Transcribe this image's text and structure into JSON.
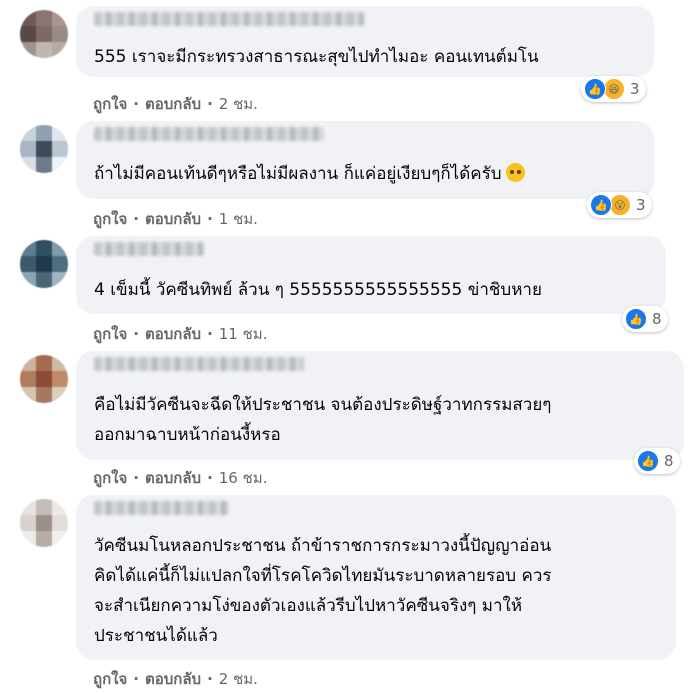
{
  "comments": [
    {
      "lines": [
        "555 เราจะมีกระทรวงสาธารณะสุขไปทำไมอะ คอนเทนต์มโน"
      ],
      "like": "ถูกใจ",
      "reply": "ตอบกลับ",
      "time": "2 ชม.",
      "reaction_count": "3",
      "reaction_icons": [
        "like-icon",
        "haha-icon"
      ],
      "avatar_colors": [
        "#6e5a55",
        "#8a7570",
        "#a8968f",
        "#5a4845",
        "#7d6a66",
        "#9a8a85",
        "#a09290",
        "#c2b6b2",
        "#b5aaa6"
      ]
    },
    {
      "lines": [
        "ถ้าไม่มีคอนเท้นดีๆหรือไม่มีผลงาน ก็แค่อยู่เงียบๆก็ได้ครับ"
      ],
      "like": "ถูกใจ",
      "reply": "ตอบกลับ",
      "time": "1 ชม.",
      "reaction_count": "3",
      "reaction_icons": [
        "like-icon",
        "wow-icon"
      ],
      "avatar_colors": [
        "#c9d3dc",
        "#8ea1b3",
        "#dfe6ec",
        "#a7b6c4",
        "#3e4a57",
        "#b9c6d2",
        "#d8dfe6",
        "#6d7c8c",
        "#eef2f5"
      ]
    },
    {
      "lines": [
        "4 เข็มนี้ วัคซีนทิพย์ ล้วน ๆ 5555555555555555 ข่าชิบหาย"
      ],
      "like": "ถูกใจ",
      "reply": "ตอบกลับ",
      "time": "11 ชม.",
      "reaction_count": "8",
      "reaction_icons": [
        "like-icon"
      ],
      "avatar_colors": [
        "#5e7d8f",
        "#2f4f63",
        "#7f9cad",
        "#3d5a6c",
        "#1f3a4c",
        "#4f6e80",
        "#8aa5b4",
        "#4a6677",
        "#9fb5c2"
      ]
    },
    {
      "lines": [
        "คือไม่มีวัคซีนจะฉีดให้ประชาชน จนต้องประดิษฐ์วาทกรรมสวยๆ",
        "ออกมาฉาบหน้าก่อนงี้หรอ"
      ],
      "like": "ถูกใจ",
      "reply": "ตอบกลับ",
      "time": "16 ชม.",
      "reaction_count": "8",
      "reaction_icons": [
        "like-icon"
      ],
      "avatar_colors": [
        "#c9b49d",
        "#a86a4f",
        "#cdbba6",
        "#b07c5e",
        "#8a4a34",
        "#c08a6a",
        "#d5c4b2",
        "#a5785f",
        "#dccdbd"
      ]
    },
    {
      "lines": [
        "วัคซีนมโนหลอกประชาชน ถ้าข้าราชการกระมาวงนี้ปัญญาอ่อน",
        "คิดได้แค่นี้ก็ไม่แปลกใจที่โรคโควิดไทยมันระบาดหลายรอบ ควร",
        "จะสำเนียกความโง่ของตัวเองแล้วรีบไปหาวัคซีนจริงๆ มาให้",
        "ประชาชนได้แล้ว"
      ],
      "like": "ถูกใจ",
      "reply": "ตอบกลับ",
      "time": "2 ชม.",
      "reaction_count": "",
      "reaction_icons": [],
      "avatar_colors": [
        "#e6e2e0",
        "#c7bdb8",
        "#ebe8e6",
        "#d9d2ce",
        "#9c8f88",
        "#e2ddd9",
        "#eeebe9",
        "#b8aca6",
        "#f2f0ee"
      ]
    }
  ]
}
